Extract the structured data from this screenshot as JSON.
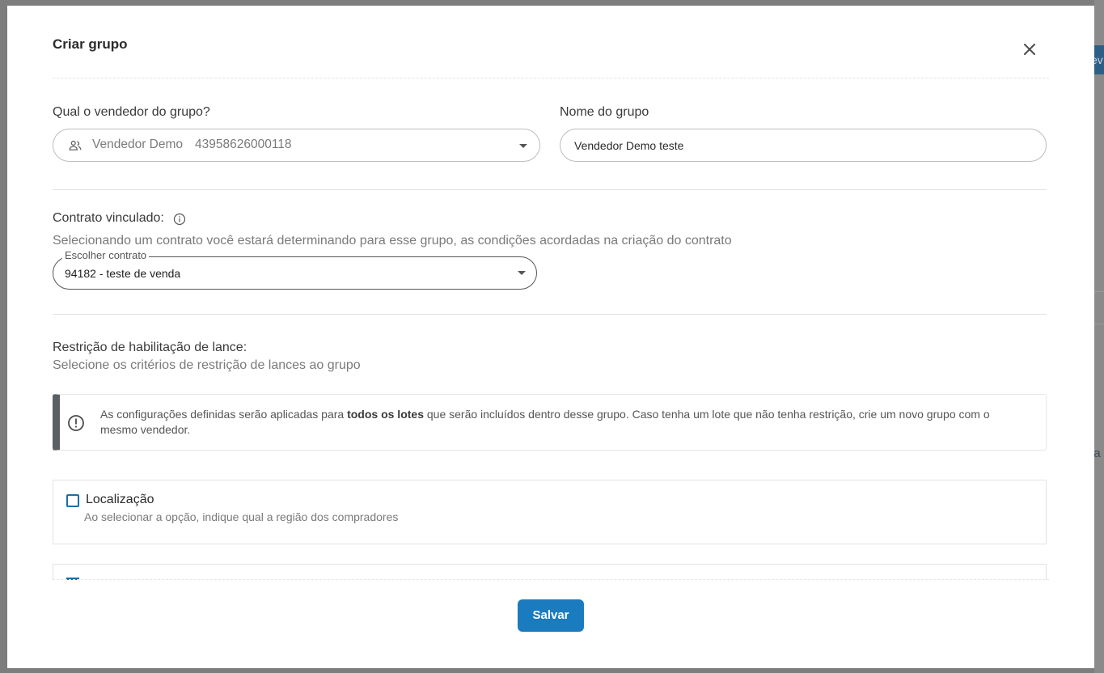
{
  "modal": {
    "title": "Criar grupo",
    "seller": {
      "label": "Qual o vendedor do grupo?",
      "selected_name": "Vendedor Demo",
      "selected_document": "43958626000118"
    },
    "group_name": {
      "label": "Nome do grupo",
      "value": "Vendedor Demo teste"
    },
    "contract": {
      "label": "Contrato vinculado:",
      "description": "Selecionando um contrato você estará determinando para esse grupo, as condições acordadas na criação do contrato",
      "select_legend": "Escolher contrato",
      "selected_value": "94182 - teste de venda"
    },
    "restriction": {
      "title": "Restrição de habilitação de lance:",
      "description": "Selecione os critérios de restrição de lances ao grupo",
      "alert_prefix": "As configurações definidas serão aplicadas para ",
      "alert_bold": "todos os lotes",
      "alert_suffix": " que serão incluídos dentro desse grupo. Caso tenha um lote que não tenha restrição, crie um novo grupo com o mesmo vendedor.",
      "options": [
        {
          "title": "Localização",
          "description": "Ao selecionar a opção, indique qual a região dos compradores",
          "checked": false
        }
      ]
    },
    "save_label": "Salvar"
  },
  "background": {
    "tab_text": "ev",
    "side_text": "ia"
  },
  "colors": {
    "primary": "#1b7bbf",
    "checkbox_border": "#1a6fa3",
    "alert_bar": "#5c6064"
  },
  "icons": [
    "close-icon",
    "users-icon",
    "chevron-down-icon",
    "info-icon",
    "alert-circle-icon"
  ]
}
